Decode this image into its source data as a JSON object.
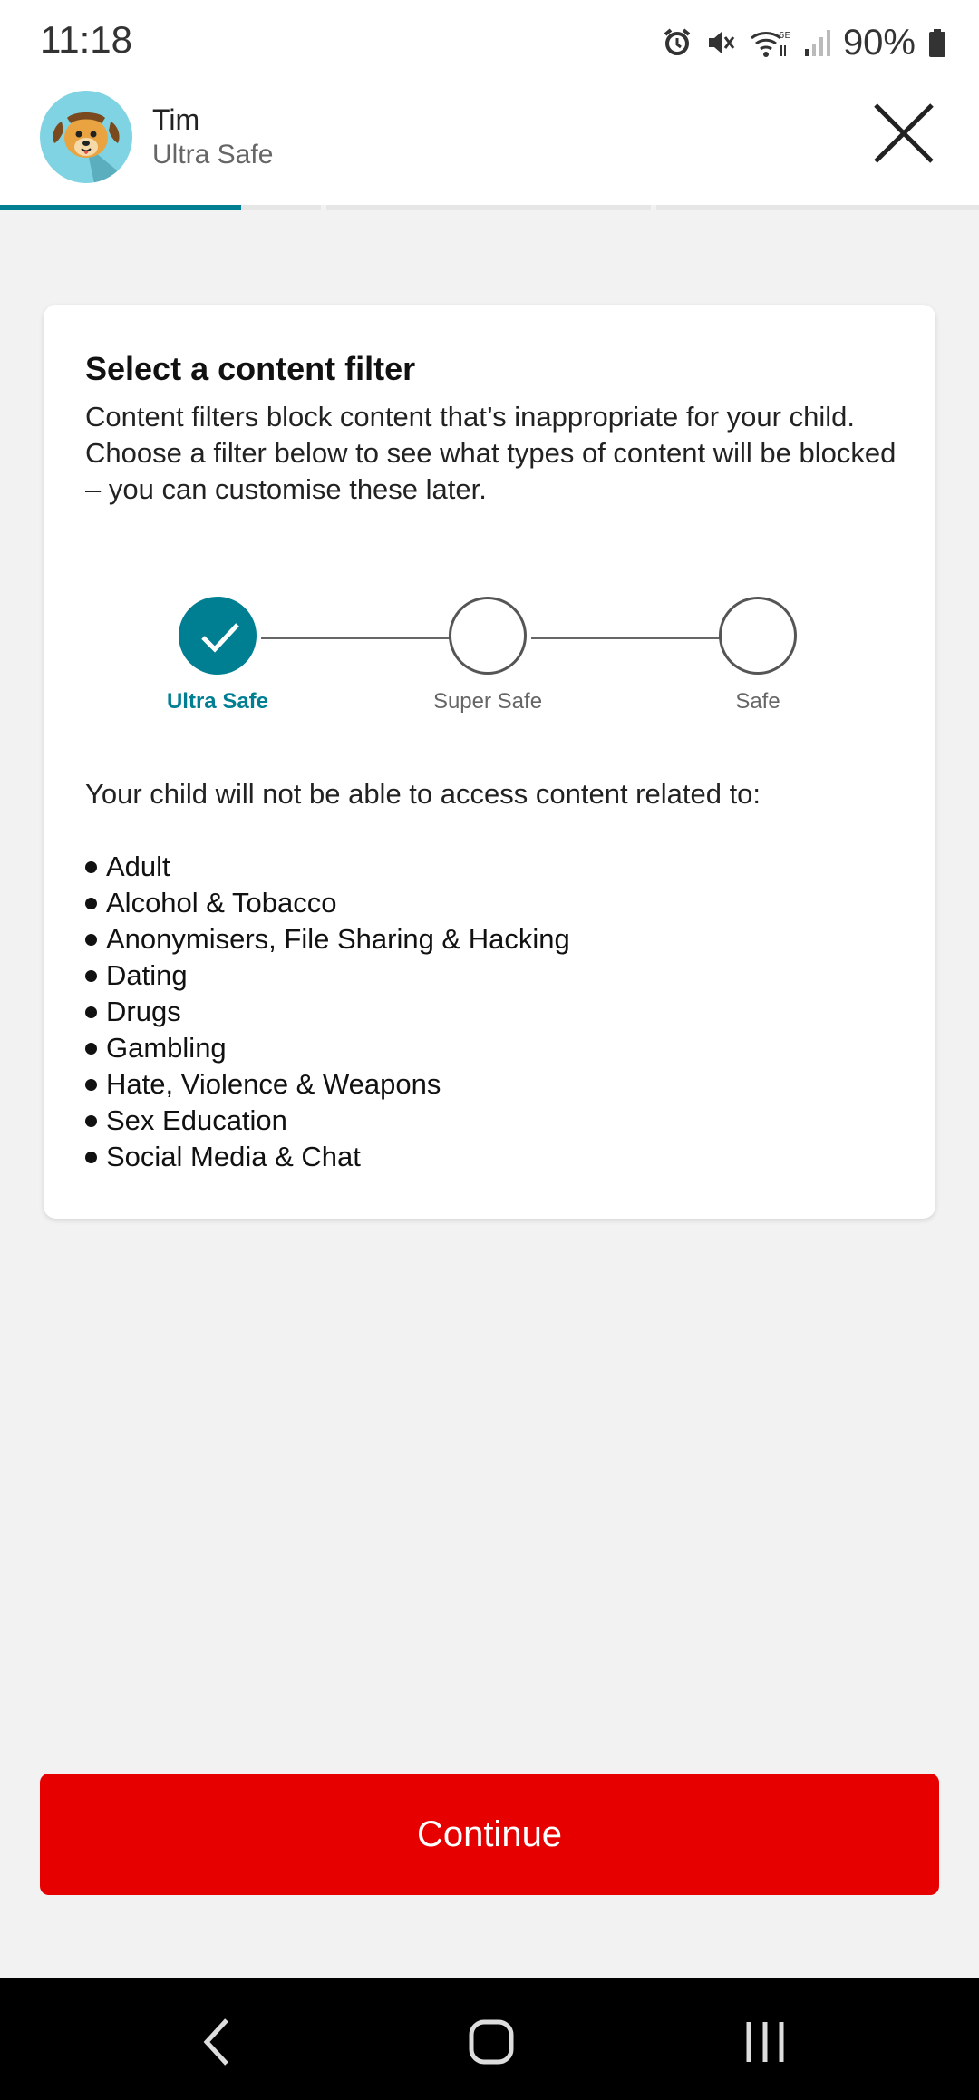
{
  "status": {
    "time": "11:18",
    "battery_percent": "90%",
    "icons": [
      "alarm-icon",
      "mute-icon",
      "wifi-6e-icon",
      "signal-icon",
      "battery-icon"
    ]
  },
  "header": {
    "name": "Tim",
    "subtitle": "Ultra Safe",
    "avatar_icon": "dog-avatar-icon",
    "close_icon": "close-icon"
  },
  "progress": {
    "steps_total": 3,
    "current_step": 1,
    "current_step_fraction": 0.75
  },
  "card": {
    "title": "Select a content filter",
    "description": "Content filters block content that’s inappropriate for your child. Choose a filter below to see what types of content will be blocked – you can customise these later.",
    "filters": [
      {
        "label": "Ultra Safe",
        "selected": true
      },
      {
        "label": "Super Safe",
        "selected": false
      },
      {
        "label": "Safe",
        "selected": false
      }
    ],
    "intro": "Your child will not be able to access content related to:",
    "categories": [
      "Adult",
      "Alcohol & Tobacco",
      "Anonymisers, File Sharing & Hacking",
      "Dating",
      "Drugs",
      "Gambling",
      "Hate, Violence & Weapons",
      "Sex Education",
      "Social Media & Chat"
    ]
  },
  "continue_label": "Continue",
  "colors": {
    "accent": "#007e92",
    "primary_button": "#e60000",
    "background": "#f2f2f2"
  },
  "navbar": {
    "icons": [
      "back-icon",
      "home-icon",
      "recents-icon"
    ]
  }
}
